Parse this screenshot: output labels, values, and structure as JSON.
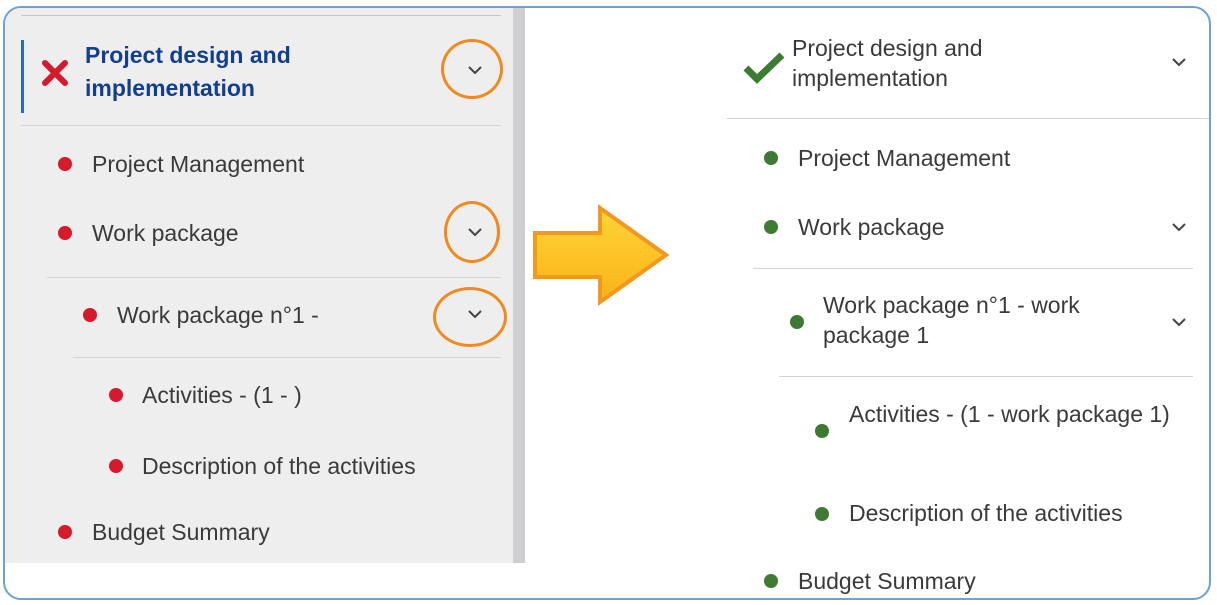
{
  "colors": {
    "before_status": "#d6192b",
    "after_status": "#3e7a32",
    "active_title": "#123e8f",
    "highlight_circle": "#f08a1c",
    "arrow_fill": "#fbbf1e",
    "arrow_stroke": "#f29720",
    "frame_border": "#6aa3d8"
  },
  "before": {
    "status_icon": "x-icon",
    "section_title": "Project design and implementation",
    "items": {
      "project_management": "Project Management",
      "work_package": "Work package",
      "work_package_1": "Work package n°1 -",
      "activities": "Activities - (1 - )",
      "description": "Description of the activities",
      "budget_summary": "Budget Summary"
    }
  },
  "transition_icon": "right-arrow-icon",
  "after": {
    "status_icon": "checkmark-icon",
    "section_title": "Project design and implementation",
    "items": {
      "project_management": "Project Management",
      "work_package": "Work package",
      "work_package_1": "Work package n°1 - work package 1",
      "activities": "Activities - (1 - work package 1)",
      "description": "Description of the activities",
      "budget_summary": "Budget Summary"
    }
  }
}
